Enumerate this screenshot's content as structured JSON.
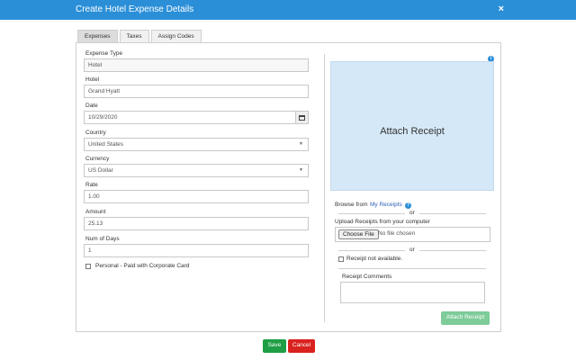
{
  "dialog": {
    "title": "Create Hotel Expense Details",
    "close_glyph": "×"
  },
  "tabs": [
    {
      "label": "Expenses",
      "active": true
    },
    {
      "label": "Taxes",
      "active": false
    },
    {
      "label": "Assign Codes",
      "active": false
    }
  ],
  "form": {
    "expense_type": {
      "label": "Expense Type",
      "value": "Hotel"
    },
    "hotel": {
      "label": "Hotel",
      "value": "Grand Hyatt"
    },
    "date": {
      "label": "Date",
      "value": "10/29/2020",
      "icon": "calendar-icon"
    },
    "country": {
      "label": "Country",
      "value": "United States"
    },
    "currency": {
      "label": "Currency",
      "value": "US Dollar"
    },
    "rate": {
      "label": "Rate",
      "value": "1.00"
    },
    "amount": {
      "label": "Amount",
      "value": "25.13"
    },
    "num_days": {
      "label": "Num of Days",
      "value": "1"
    },
    "personal_card": {
      "label": "Personal - Paid with Corporate Card",
      "checked": false
    }
  },
  "receipt": {
    "dropzone_text": "Attach Receipt",
    "browse_from": "Browse from",
    "my_receipts": "My Receipts",
    "or_1": "or",
    "upload_label": "Upload Receipts from your computer",
    "choose_file": "Choose File",
    "no_file": "No file chosen",
    "or_2": "or",
    "not_available": {
      "label": "Receipt not available.",
      "checked": false
    },
    "comments_label": "Receipt Comments",
    "comments_value": "",
    "attach_button": "Attach Receipt"
  },
  "footer": {
    "save": "Save",
    "cancel": "Cancel"
  },
  "colors": {
    "titlebar": "#2b8fd8",
    "save": "#1e9e45",
    "cancel": "#d9211e",
    "attach": "#7dcc99",
    "dropzone": "#d5e8f7"
  }
}
